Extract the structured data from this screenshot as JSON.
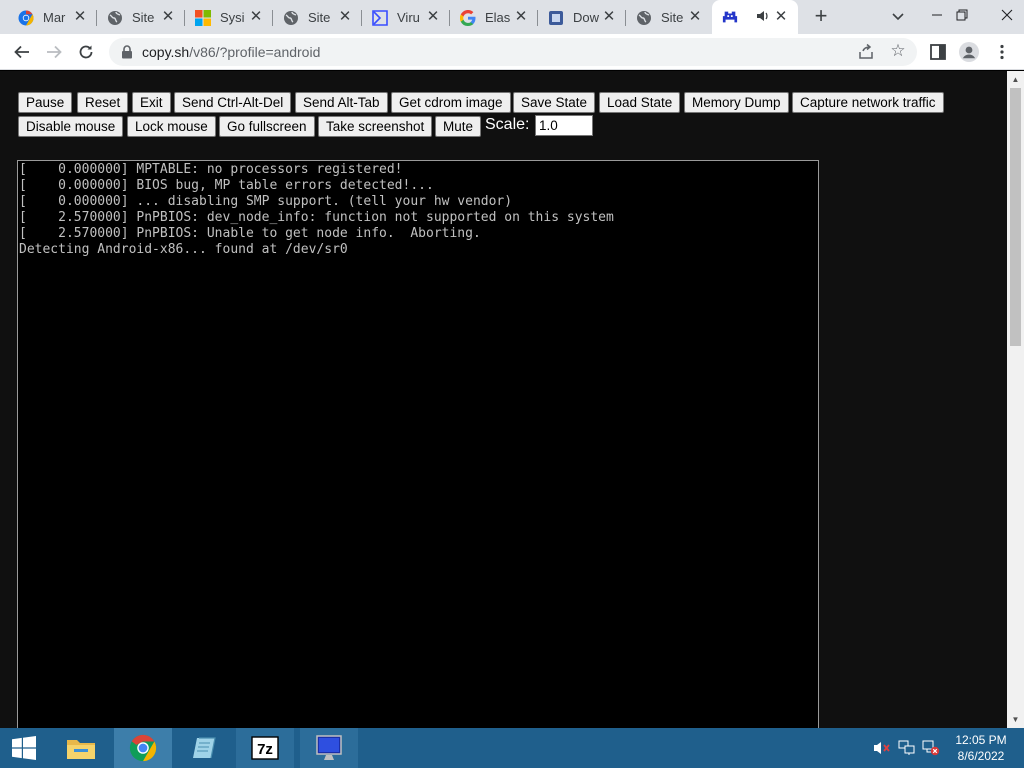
{
  "browser": {
    "tabs": [
      {
        "label": "Mar",
        "icon": "chromium-icon"
      },
      {
        "label": "Site",
        "icon": "globe-icon"
      },
      {
        "label": "Sysi",
        "icon": "microsoft-icon"
      },
      {
        "label": "Site",
        "icon": "globe-icon"
      },
      {
        "label": "Viru",
        "icon": "virustotal-icon"
      },
      {
        "label": "Elas",
        "icon": "google-icon"
      },
      {
        "label": "Dow",
        "icon": "download-site-icon"
      },
      {
        "label": "Site",
        "icon": "globe-icon"
      },
      {
        "label": "",
        "icon": "v86-icon",
        "active": true,
        "audio": true
      }
    ],
    "address": {
      "host": "copy.sh",
      "path": "/v86/?profile=android"
    }
  },
  "controls": {
    "row1": [
      "Pause",
      "Reset",
      "Exit",
      "Send Ctrl-Alt-Del",
      "Send Alt-Tab",
      "Get cdrom image",
      "Save State",
      "Load State",
      "Memory Dump",
      "Capture network traffic"
    ],
    "row2": [
      "Disable mouse",
      "Lock mouse",
      "Go fullscreen",
      "Take screenshot",
      "Mute"
    ],
    "scale_label": "Scale:",
    "scale_value": "1.0"
  },
  "console": {
    "lines": [
      "[    0.000000] MPTABLE: no processors registered!",
      "[    0.000000] BIOS bug, MP table errors detected!...",
      "[    0.000000] ... disabling SMP support. (tell your hw vendor)",
      "[    2.570000] PnPBIOS: dev_node_info: function not supported on this system",
      "[    2.570000] PnPBIOS: Unable to get node info.  Aborting.",
      "Detecting Android-x86... found at /dev/sr0"
    ]
  },
  "taskbar": {
    "time": "12:05 PM",
    "date": "8/6/2022",
    "apps": [
      "file-explorer-icon",
      "chrome-icon",
      "notepad-icon",
      "7zip-icon",
      "remote-desktop-icon"
    ],
    "tray": [
      "volume-muted-icon",
      "network-icon",
      "network-error-icon"
    ]
  },
  "colors": {
    "page_background": "#101010",
    "console_text": "#c0c0c0",
    "taskbar": "#1f5f8c",
    "tabstrip": "#dee1e6"
  }
}
